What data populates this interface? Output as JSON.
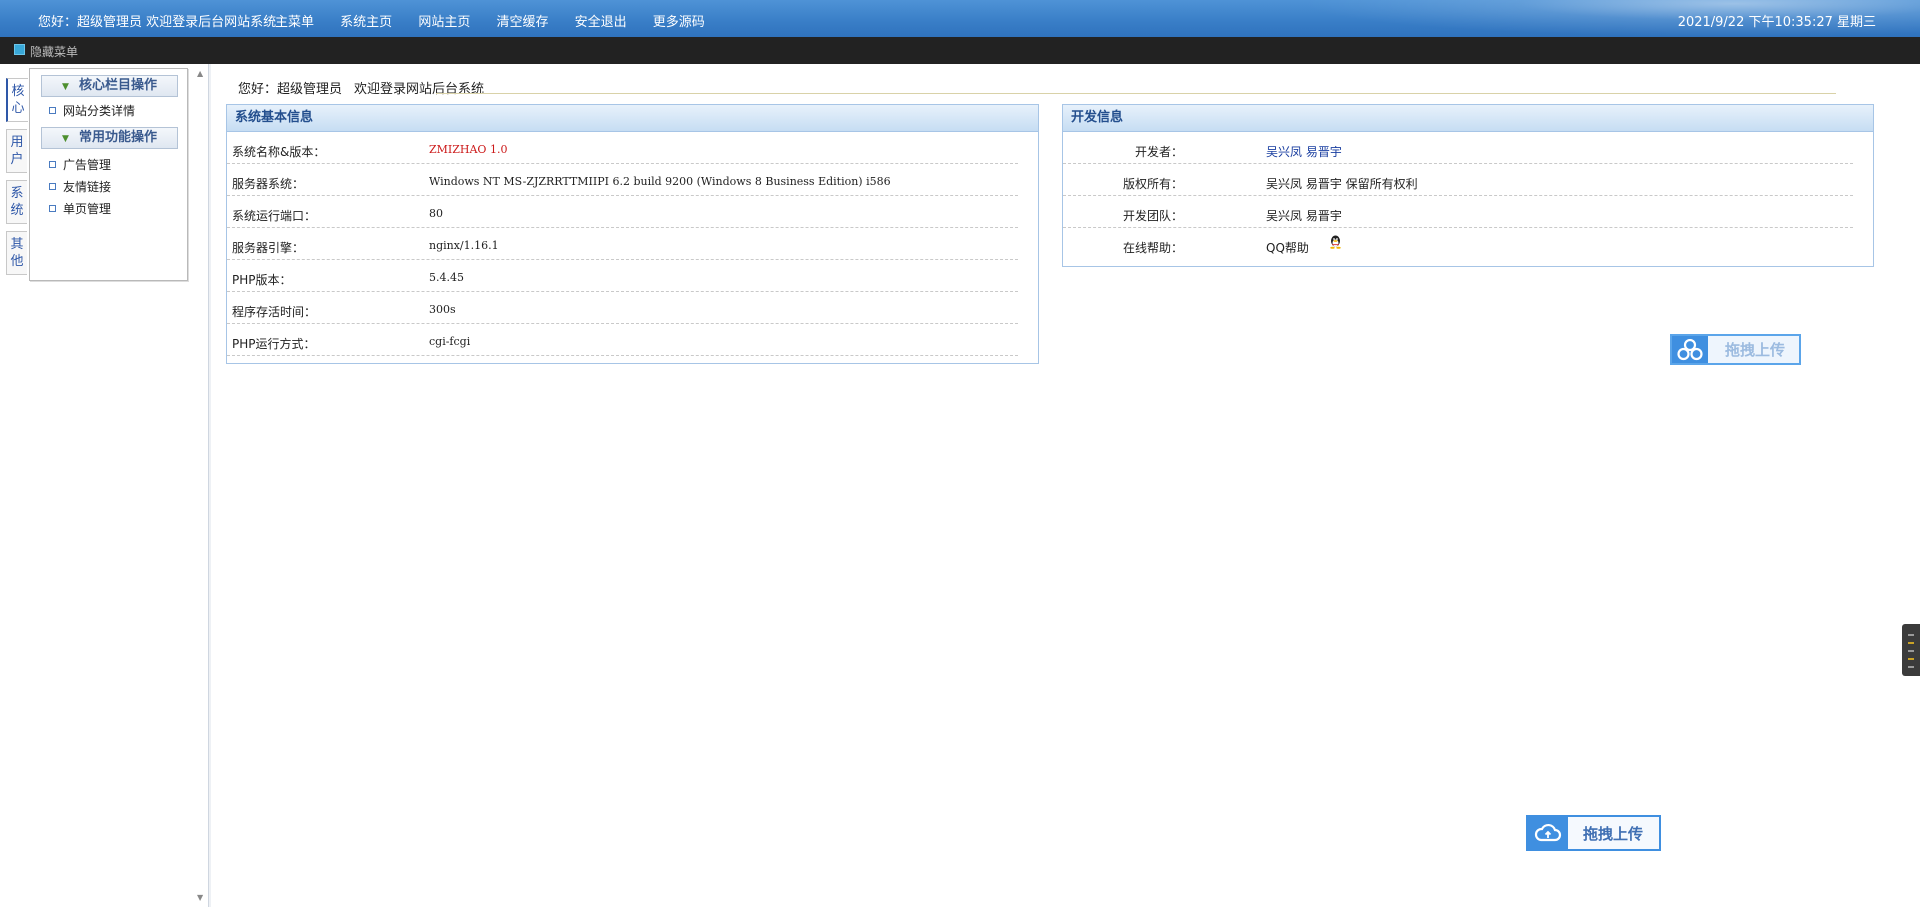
{
  "topbar": {
    "welcome": "您好：超级管理员 欢迎登录后台网站系统",
    "nav": [
      "主菜单",
      "系统主页",
      "网站主页",
      "清空缓存",
      "安全退出",
      "更多源码"
    ],
    "clock": "2021/9/22 下午10:35:27 星期三"
  },
  "darkbar": {
    "hide_label": "隐藏菜单"
  },
  "vtabs": [
    {
      "label": "核心"
    },
    {
      "label": "用户"
    },
    {
      "label": "系统"
    },
    {
      "label": "其他"
    }
  ],
  "sidebar": {
    "groups": [
      {
        "title": "核心栏目操作",
        "items": [
          "网站分类详情"
        ]
      },
      {
        "title": "常用功能操作",
        "items": [
          "广告管理",
          "友情链接",
          "单页管理"
        ]
      }
    ]
  },
  "greeting": {
    "hello": "您好：超级管理员",
    "message": "欢迎登录网站后台系统"
  },
  "system_panel": {
    "title": "系统基本信息",
    "rows": [
      {
        "key": "系统名称&版本：",
        "value": "ZMIZHAO 1.0"
      },
      {
        "key": "服务器系统：",
        "value": "Windows NT MS-ZJZRRTTMIIPI 6.2 build 9200 (Windows 8 Business Edition) i586"
      },
      {
        "key": "系统运行端口：",
        "value": "80"
      },
      {
        "key": "服务器引擎：",
        "value": "nginx/1.16.1"
      },
      {
        "key": "PHP版本：",
        "value": "5.4.45"
      },
      {
        "key": "程序存活时间：",
        "value": "300s"
      },
      {
        "key": "PHP运行方式：",
        "value": "cgi-fcgi"
      }
    ]
  },
  "dev_panel": {
    "title": "开发信息",
    "rows": [
      {
        "key": "开发者：",
        "value": "吴兴凤 易晋宇"
      },
      {
        "key": "版权所有：",
        "value": "吴兴凤 易晋宇 保留所有权利"
      },
      {
        "key": "开发团队：",
        "value": "吴兴凤 易晋宇"
      },
      {
        "key": "在线帮助：",
        "value": "QQ帮助"
      }
    ]
  },
  "upload_buttons": [
    "拖拽上传",
    "拖拽上传"
  ],
  "colors": {
    "topbar": "#3a7fc8",
    "panel_border": "#a7c5e6",
    "accent_red": "#cc1a1a",
    "link_blue": "#1a3ea0"
  }
}
